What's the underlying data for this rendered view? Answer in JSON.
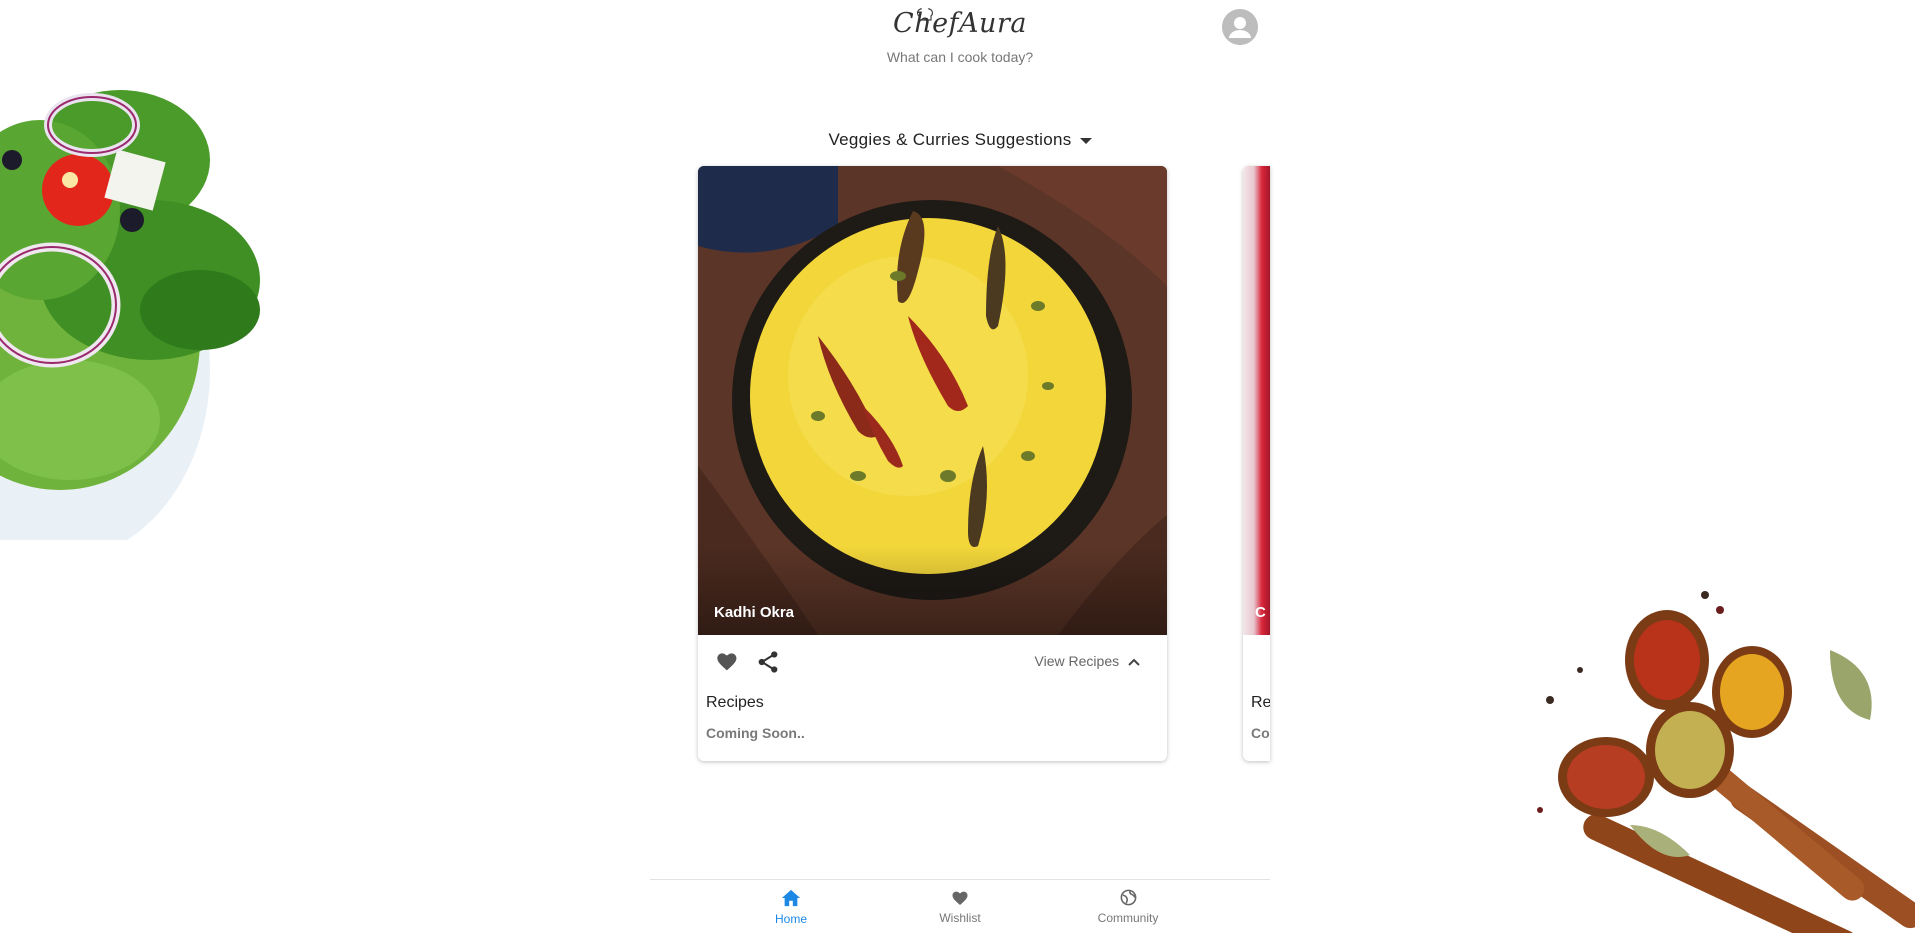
{
  "header": {
    "logo_text": "ChefAura",
    "tagline": "What can I cook today?"
  },
  "category": {
    "label": "Veggies & Curries Suggestions",
    "icon": "caret-down-icon"
  },
  "cards": [
    {
      "title": "Kadhi Okra",
      "view_label": "View Recipes",
      "recipes_heading": "Recipes",
      "recipes_status": "Coming Soon..",
      "actions": [
        "heart-icon",
        "share-icon",
        "chevron-up-icon"
      ]
    },
    {
      "title_partial": "C",
      "recipes_heading_partial": "Re",
      "recipes_status_partial": "Co"
    }
  ],
  "bottom_nav": {
    "items": [
      {
        "label": "Home",
        "icon": "home-icon",
        "active": true
      },
      {
        "label": "Wishlist",
        "icon": "heart-icon",
        "active": false
      },
      {
        "label": "Community",
        "icon": "globe-icon",
        "active": false
      }
    ]
  },
  "colors": {
    "accent": "#1e88e5",
    "muted_text": "#777777",
    "curry_yellow": "#f2d63a",
    "bowl": "#1e1a16",
    "cloth": "#5b3527"
  }
}
